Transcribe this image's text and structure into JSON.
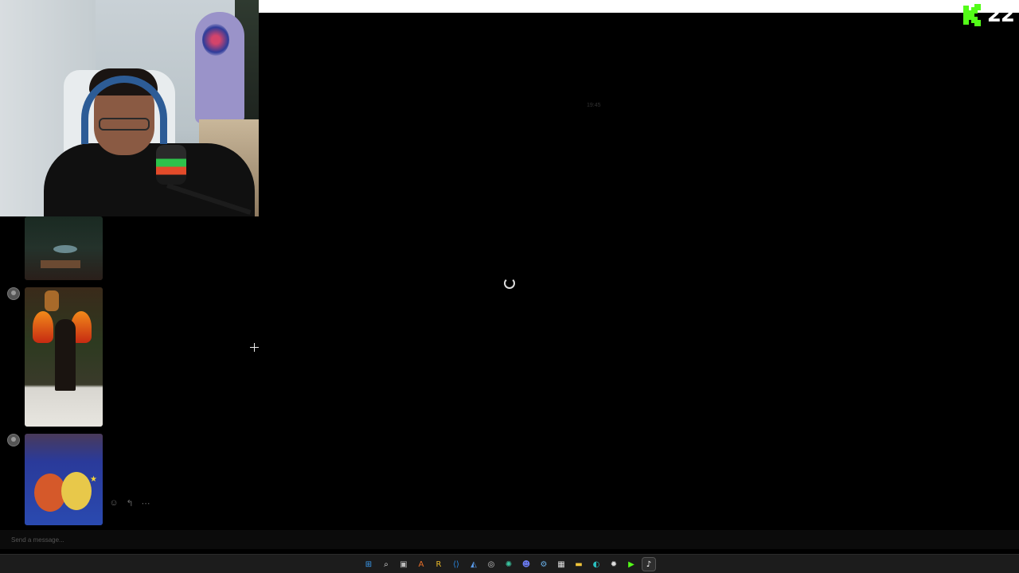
{
  "stream": {
    "viewer_count": "22",
    "platform_logo": "kick-logo",
    "brand_color": "#53fc18"
  },
  "viewer": {
    "time_label": "19:45"
  },
  "chat": {
    "input_placeholder": "Send a message...",
    "messages": [
      {
        "type": "image",
        "avatar": "user-avatar"
      },
      {
        "type": "image",
        "avatar": "user-avatar"
      },
      {
        "type": "image",
        "avatar": "user-avatar"
      }
    ],
    "actions": [
      {
        "icon": "react-icon",
        "glyph": "☺"
      },
      {
        "icon": "reply-icon",
        "glyph": "↰"
      },
      {
        "icon": "more-icon",
        "glyph": "⋯"
      }
    ]
  },
  "taskbar": {
    "icons": [
      {
        "name": "start-icon",
        "glyph": "⊞",
        "color": "#3a9bf0"
      },
      {
        "name": "search-icon",
        "glyph": "⌕",
        "color": "#e0e0e0"
      },
      {
        "name": "task-view-icon",
        "glyph": "▣",
        "color": "#bbbbbb"
      },
      {
        "name": "app-a-icon",
        "glyph": "A",
        "color": "#e8702a"
      },
      {
        "name": "app-r-icon",
        "glyph": "R",
        "color": "#e8b82a"
      },
      {
        "name": "vscode-icon",
        "glyph": "⟨⟩",
        "color": "#2a8ae8"
      },
      {
        "name": "gallery-icon",
        "glyph": "◭",
        "color": "#5a9ae8"
      },
      {
        "name": "obs-icon",
        "glyph": "◎",
        "color": "#cccccc"
      },
      {
        "name": "chatgpt-icon",
        "glyph": "✺",
        "color": "#3ac4a0"
      },
      {
        "name": "discord-icon",
        "glyph": "☻",
        "color": "#6a7af0"
      },
      {
        "name": "steam-icon",
        "glyph": "⚙",
        "color": "#6ab0e8"
      },
      {
        "name": "calendar-icon",
        "glyph": "▦",
        "color": "#dddddd"
      },
      {
        "name": "file-explorer-icon",
        "glyph": "▬",
        "color": "#f0c43a"
      },
      {
        "name": "edge-icon",
        "glyph": "◐",
        "color": "#2ac0c0"
      },
      {
        "name": "settings-icon",
        "glyph": "✹",
        "color": "#dddddd"
      },
      {
        "name": "kick-app-icon",
        "glyph": "▶",
        "color": "#53fc18"
      },
      {
        "name": "tiktok-icon",
        "glyph": "♪",
        "color": "#ffffff"
      }
    ],
    "active_index": 16
  }
}
